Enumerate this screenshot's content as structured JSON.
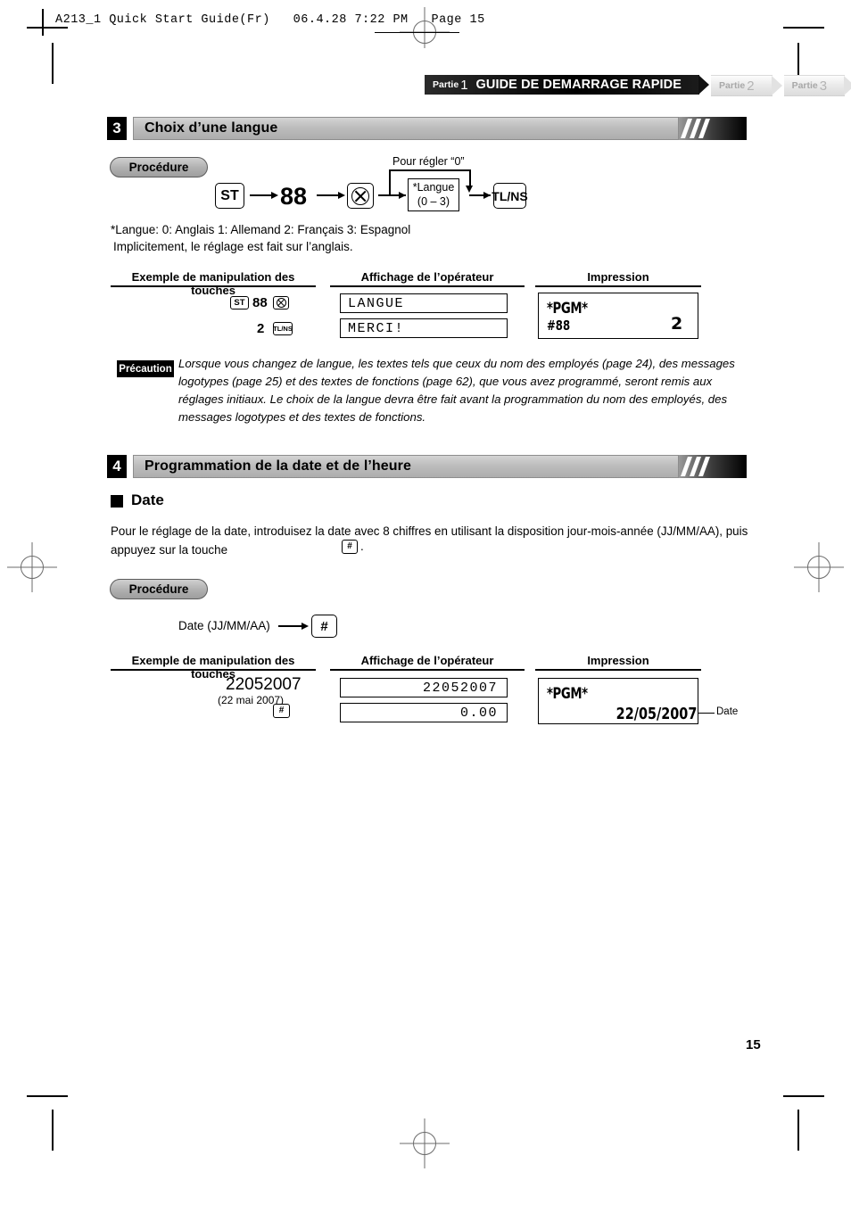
{
  "page": {
    "file_header": "A213_1 Quick Start Guide(Fr)   06.4.28 7:22 PM   Page 15",
    "page_number": "15"
  },
  "part_banner": {
    "active": {
      "word": "Partie",
      "num": "1",
      "title": "GUIDE DE DEMARRAGE RAPIDE"
    },
    "tabs": [
      {
        "word": "Partie",
        "num": "2"
      },
      {
        "word": "Partie",
        "num": "3"
      }
    ]
  },
  "section3": {
    "number": "3",
    "title": "Choix d’une langue",
    "procedure_label": "Procédure",
    "flow": {
      "key_st": "ST",
      "code": "88",
      "multiply_icon": "multiply-circle-icon",
      "bypass_label": "Pour régler “0”",
      "box_line1": "*Langue",
      "box_line2": "(0 – 3)",
      "key_tlns": "TL/NS"
    },
    "legend_line1": "*Langue:  0: Anglais    1: Allemand     2: Français     3: Espagnol",
    "legend_line2": "Implicitement, le réglage est fait sur l’anglais.",
    "table": {
      "col1": "Exemple de manipulation des touches",
      "col2": "Affichage de l’opérateur",
      "col3": "Impression",
      "keys_row1_st": "ST",
      "keys_row1_num": "88",
      "keys_row1_mult": "multiply-circle-icon",
      "keys_row2_num": "2",
      "keys_row2_tlns": "TL/NS",
      "display_row1": "LANGUE",
      "display_row2": "MERCI!",
      "print_title": "*PGM*",
      "print_code": "#88",
      "print_value": "2"
    },
    "caution": {
      "badge": "Précaution",
      "text": "Lorsque vous changez de langue, les textes tels que ceux du nom des employés (page 24), des messages logotypes (page 25) et des textes de fonctions (page 62), que vous avez programmé, seront remis aux réglages initiaux. Le choix de la langue devra être fait avant la programmation du nom des employés, des messages logotypes et des textes de fonctions."
    }
  },
  "section4": {
    "number": "4",
    "title": "Programmation de la date et de l’heure",
    "subsection_title": "Date",
    "paragraph_part1": "Pour le réglage de la date, introduisez la date avec 8 chiffres en utilisant la disposition jour-mois-année (JJ/MM/AA), puis appuyez sur la touche",
    "paragraph_key": "#",
    "paragraph_part2": ".",
    "procedure_label": "Procédure",
    "flow": {
      "input_label": "Date (JJ/MM/AA)",
      "key_hash": "#"
    },
    "table": {
      "col1": "Exemple de manipulation des touches",
      "col2": "Affichage de l’opérateur",
      "col3": "Impression",
      "keys_row1": "22052007",
      "keys_row1_note": "(22 mai 2007)",
      "keys_row2_hash": "#",
      "display_row1": "22052007",
      "display_row2": "0.00",
      "print_title": "*PGM*",
      "print_date": "22/05/2007",
      "callout": "Date"
    }
  }
}
